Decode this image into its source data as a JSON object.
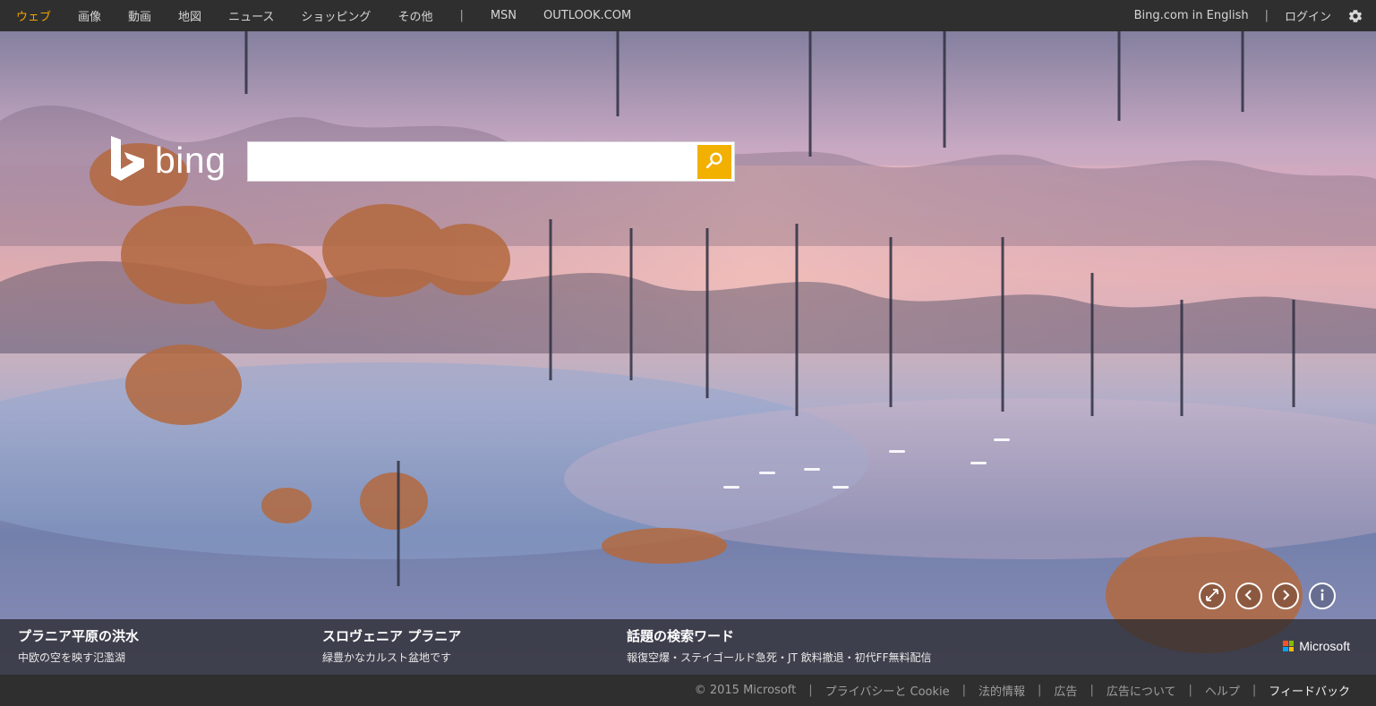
{
  "topnav": {
    "left_items": [
      {
        "label": "ウェブ",
        "active": true
      },
      {
        "label": "画像",
        "active": false
      },
      {
        "label": "動画",
        "active": false
      },
      {
        "label": "地図",
        "active": false
      },
      {
        "label": "ニュース",
        "active": false
      },
      {
        "label": "ショッピング",
        "active": false
      },
      {
        "label": "その他",
        "active": false
      }
    ],
    "separator": "|",
    "extra_items": [
      {
        "label": "MSN"
      },
      {
        "label": "OUTLOOK.COM"
      }
    ],
    "right_items": [
      {
        "label": "Bing.com in English"
      },
      {
        "label": "ログイン"
      }
    ],
    "settings_icon": "gear-icon"
  },
  "brand": {
    "name": "bing",
    "logo_icon": "bing-logo-icon"
  },
  "search": {
    "value": "",
    "placeholder": "",
    "button_icon": "search-icon",
    "button_color": "#f2b000"
  },
  "controls": [
    {
      "icon": "expand-icon"
    },
    {
      "icon": "chevron-left-icon"
    },
    {
      "icon": "chevron-right-icon"
    },
    {
      "icon": "info-icon"
    }
  ],
  "infobar": {
    "items": [
      {
        "title": "プラニア平原の洪水",
        "subtitle": "中欧の空を映す氾濫湖"
      },
      {
        "title": "スロヴェニア プラニア",
        "subtitle": "緑豊かなカルスト盆地です"
      },
      {
        "title": "話題の検索ワード",
        "subtitle": "報復空爆・ステイゴールド急死・JT 飲料撤退・初代FF無料配信"
      }
    ],
    "brand": "Microsoft"
  },
  "footer": {
    "items": [
      "© 2015 Microsoft",
      "プライバシーと Cookie",
      "法的情報",
      "広告",
      "広告について",
      "ヘルプ"
    ],
    "feedback": "フィードバック"
  },
  "colors": {
    "accent": "#f2a400",
    "topbar": "#2f2f2f",
    "search_button": "#f2b000"
  }
}
